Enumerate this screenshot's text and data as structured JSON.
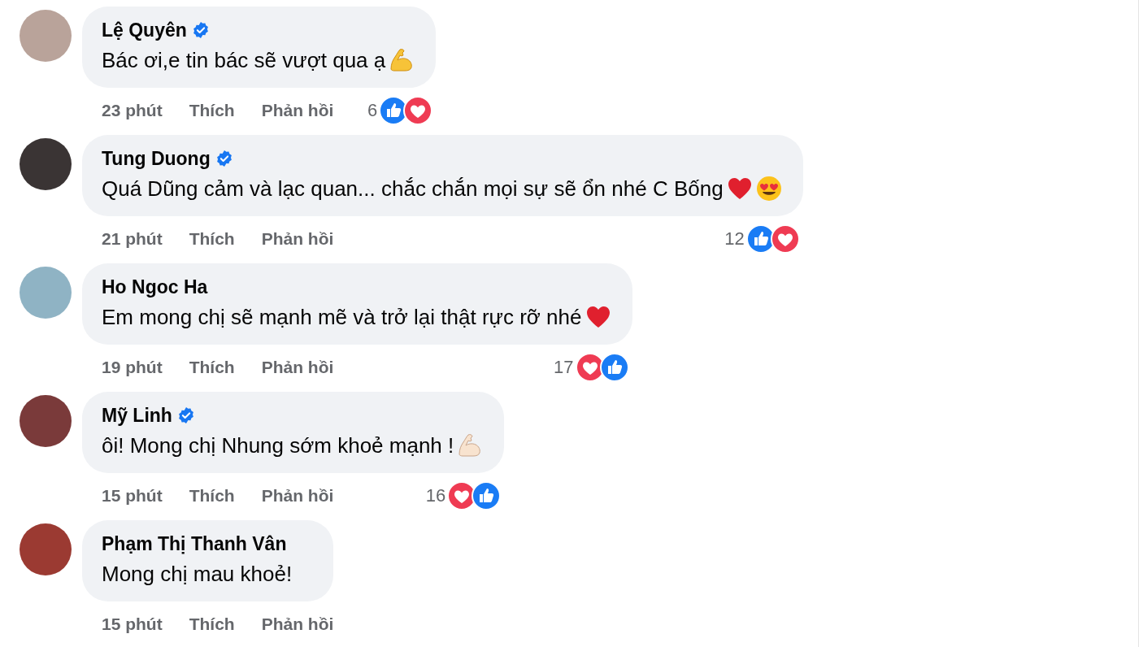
{
  "comments": [
    {
      "name": "Lệ Quyên",
      "verified": true,
      "message": "Bác ơi,e tin bác sẽ vượt qua ạ",
      "emoji": [
        {
          "kind": "muscle"
        }
      ],
      "time": "23 phút",
      "like": "Thích",
      "reply": "Phản hồi",
      "reaction_count": "6",
      "reactions": [
        {
          "kind": "like"
        },
        {
          "kind": "love"
        }
      ]
    },
    {
      "name": "Tung Duong",
      "verified": true,
      "message": "Quá Dũng cảm và lạc quan... chắc chắn mọi sự sẽ ổn nhé C Bống",
      "emoji": [
        {
          "kind": "heart"
        },
        {
          "kind": "heart-eyes"
        }
      ],
      "time": "21 phút",
      "like": "Thích",
      "reply": "Phản hồi",
      "reaction_count": "12",
      "reactions": [
        {
          "kind": "like"
        },
        {
          "kind": "love"
        }
      ]
    },
    {
      "name": "Ho Ngoc Ha",
      "verified": false,
      "message": "Em mong chị sẽ mạnh mẽ và trở lại thật rực rỡ nhé",
      "emoji": [
        {
          "kind": "heart"
        }
      ],
      "time": "19 phút",
      "like": "Thích",
      "reply": "Phản hồi",
      "reaction_count": "17",
      "reactions": [
        {
          "kind": "love"
        },
        {
          "kind": "like"
        }
      ]
    },
    {
      "name": "Mỹ Linh",
      "verified": true,
      "message": "ôi! Mong chị Nhung sớm khoẻ mạnh !",
      "emoji": [
        {
          "kind": "muscle-light"
        }
      ],
      "time": "15 phút",
      "like": "Thích",
      "reply": "Phản hồi",
      "reaction_count": "16",
      "reactions": [
        {
          "kind": "love"
        },
        {
          "kind": "like"
        }
      ]
    },
    {
      "name": "Phạm Thị Thanh Vân",
      "verified": false,
      "message": "Mong chị mau khoẻ!",
      "time": "15 phút",
      "like": "Thích",
      "reply": "Phản hồi"
    }
  ]
}
